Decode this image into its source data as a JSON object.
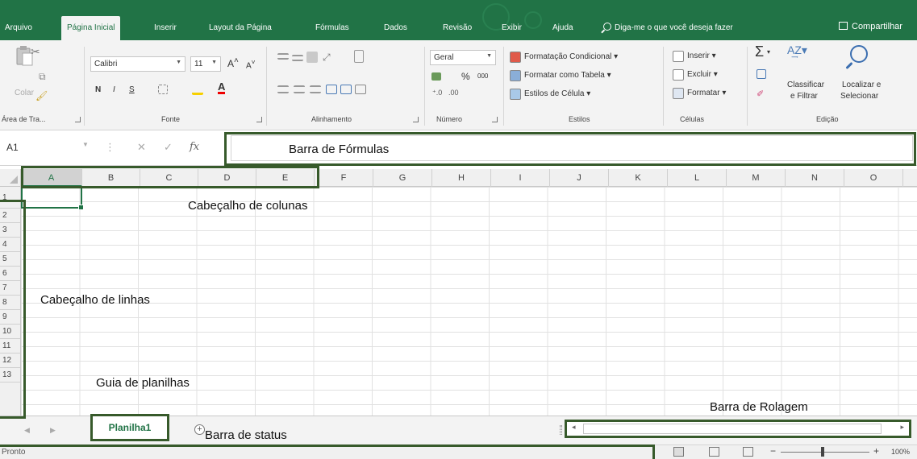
{
  "tabs": [
    {
      "label": "Arquivo",
      "active": false
    },
    {
      "label": "Página Inicial",
      "active": true
    },
    {
      "label": "Inserir",
      "active": false
    },
    {
      "label": "Layout da Página",
      "active": false
    },
    {
      "label": "Fórmulas",
      "active": false
    },
    {
      "label": "Dados",
      "active": false
    },
    {
      "label": "Revisão",
      "active": false
    },
    {
      "label": "Exibir",
      "active": false
    },
    {
      "label": "Ajuda",
      "active": false
    }
  ],
  "tellme": "Diga-me o que você deseja fazer",
  "share": "Compartilhar",
  "ribbon": {
    "clipboard": {
      "paste": "Colar",
      "label": "Área de Tra..."
    },
    "font": {
      "name": "Calibri",
      "size": "11",
      "bold": "N",
      "italic": "I",
      "underline": "S",
      "label": "Fonte"
    },
    "alignment": {
      "label": "Alinhamento"
    },
    "number": {
      "format": "Geral",
      "percent": "%",
      "thousands": "000",
      "label": "Número"
    },
    "styles": {
      "conditional": "Formatação Condicional",
      "as_table": "Formatar como Tabela",
      "cell_styles": "Estilos de Célula",
      "label": "Estilos"
    },
    "cells": {
      "insert": "Inserir",
      "delete": "Excluir",
      "format": "Formatar",
      "label": "Células"
    },
    "editing": {
      "sort_line1": "Classificar",
      "sort_line2": "e Filtrar",
      "find_line1": "Localizar e",
      "find_line2": "Selecionar",
      "label": "Edição"
    }
  },
  "formula_bar": {
    "name_box": "A1",
    "fx": "fx"
  },
  "columns": [
    "A",
    "B",
    "C",
    "D",
    "E",
    "F",
    "G",
    "H",
    "I",
    "J",
    "K",
    "L",
    "M",
    "N",
    "O"
  ],
  "rows": [
    "1",
    "2",
    "3",
    "4",
    "5",
    "6",
    "7",
    "8",
    "9",
    "10",
    "11",
    "12",
    "13"
  ],
  "sheet": {
    "tab": "Planilha1"
  },
  "status": {
    "text": "Pronto",
    "zoom": "100%"
  },
  "annotations": {
    "formula_bar": "Barra de Fórmulas",
    "column_headers": "Cabeçalho de colunas",
    "row_headers": "Cabeçalho de linhas",
    "sheet_tabs": "Guia de planilhas",
    "scroll_bar": "Barra de Rolagem",
    "status_bar": "Barra de status"
  },
  "colors": {
    "excel_green": "#217346",
    "annotation_border": "#375a2b"
  }
}
